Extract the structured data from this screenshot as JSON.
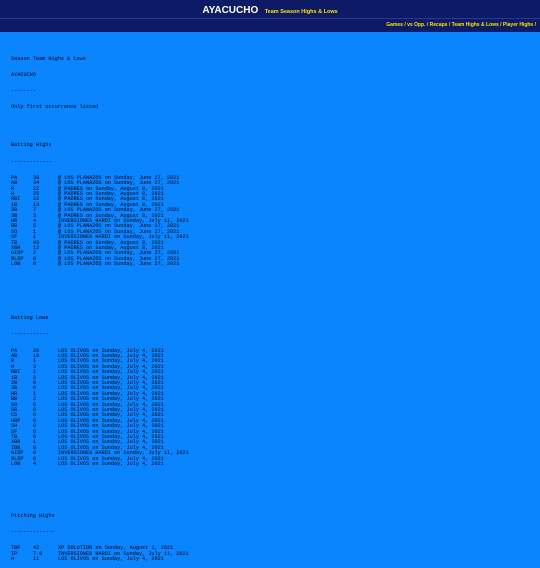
{
  "header": {
    "title": "AYACUCHO",
    "subtitle": "Team Season Highs & Lows"
  },
  "nav": [
    "Games",
    "vs Opp.",
    "Recaps",
    "Team Highs & Lows",
    "Player Highs"
  ],
  "intro": [
    "Season Team Highs & Lows",
    "AYACUCHO",
    "--------",
    "Only first occurrence listed"
  ],
  "batting_highs": {
    "title": "Batting Highs",
    "underline": "-------------",
    "rows": [
      [
        "PA",
        "39",
        "@ LOS PLANAZOS on Sunday, June 27, 2021"
      ],
      [
        "AB",
        "34",
        "@ LOS PLANAZOS on Sunday, June 27, 2021"
      ],
      [
        "R",
        "22",
        "@ PADRES on Sunday, August 8, 2021"
      ],
      [
        "H",
        "25",
        "@ PADRES on Sunday, August 8, 2021"
      ],
      [
        "RBI",
        "22",
        "@ PADRES on Sunday, August 8, 2021"
      ],
      [
        "1B",
        "13",
        "@ PADRES on Sunday, August 8, 2021"
      ],
      [
        "2B",
        "7",
        "@ LOS PLANAZOS on Sunday, June 27, 2021"
      ],
      [
        "3B",
        "3",
        "@ PADRES on Sunday, August 8, 2021"
      ],
      [
        "HR",
        "4",
        "INVERSIONES HARDI on Sunday, July 11, 2021"
      ],
      [
        "BB",
        "5",
        "@ LOS PLANAZOS on Sunday, June 27, 2021"
      ],
      [
        "SO",
        "1",
        "@ LOS PLANAZOS on Sunday, June 27, 2021"
      ],
      [
        "SF",
        "1",
        "INVERSIONES HARDI on Sunday, July 11, 2021"
      ],
      [
        "TB",
        "43",
        "@ PADRES on Sunday, August 8, 2021"
      ],
      [
        "XBH",
        "12",
        "@ PADRES on Sunday, August 8, 2021"
      ],
      [
        "GIDP",
        "2",
        "@ LOS PLANAZOS on Sunday, June 27, 2021"
      ],
      [
        "RLSP",
        "8",
        "@ LOS PLANAZOS on Sunday, June 27, 2021"
      ],
      [
        "LOB",
        "9",
        "@ LOS PLANAZOS on Sunday, June 27, 2021"
      ]
    ]
  },
  "batting_lows": {
    "title": "Batting Lows",
    "underline": "------------",
    "rows": [
      [
        "PA",
        "20",
        "LOS OLIVOS on Sunday, July 4, 2021"
      ],
      [
        "AB",
        "18",
        "LOS OLIVOS on Sunday, July 4, 2021"
      ],
      [
        "R",
        "1",
        "LOS OLIVOS on Sunday, July 4, 2021"
      ],
      [
        "H",
        "3",
        "LOS OLIVOS on Sunday, July 4, 2021"
      ],
      [
        "RBI",
        "1",
        "LOS OLIVOS on Sunday, July 4, 2021"
      ],
      [
        "1B",
        "2",
        "LOS OLIVOS on Sunday, July 4, 2021"
      ],
      [
        "2B",
        "0",
        "LOS OLIVOS on Sunday, July 4, 2021"
      ],
      [
        "3B",
        "0",
        "LOS OLIVOS on Sunday, July 4, 2021"
      ],
      [
        "HR",
        "1",
        "LOS OLIVOS on Sunday, July 4, 2021"
      ],
      [
        "BB",
        "2",
        "LOS OLIVOS on Sunday, July 4, 2021"
      ],
      [
        "SO",
        "6",
        "LOS OLIVOS on Sunday, July 4, 2021"
      ],
      [
        "SB",
        "0",
        "LOS OLIVOS on Sunday, July 4, 2021"
      ],
      [
        "CS",
        "0",
        "LOS OLIVOS on Sunday, July 4, 2021"
      ],
      [
        "HBP",
        "0",
        "LOS OLIVOS on Sunday, July 4, 2021"
      ],
      [
        "SH",
        "0",
        "LOS OLIVOS on Sunday, July 4, 2021"
      ],
      [
        "SF",
        "0",
        "LOS OLIVOS on Sunday, July 4, 2021"
      ],
      [
        "TB",
        "6",
        "LOS OLIVOS on Sunday, July 4, 2021"
      ],
      [
        "XBH",
        "1",
        "LOS OLIVOS on Sunday, July 4, 2021"
      ],
      [
        "IBB",
        "0",
        "LOS OLIVOS on Sunday, July 4, 2021"
      ],
      [
        "GIDP",
        "0",
        "INVERSIONES HARDI on Sunday, July 11, 2021"
      ],
      [
        "RLSP",
        "0",
        "LOS OLIVOS on Sunday, July 4, 2021"
      ],
      [
        "LOB",
        "4",
        "LOS OLIVOS on Sunday, July 4, 2021"
      ]
    ]
  },
  "pitching_highs": {
    "title": "Pitching Highs",
    "underline": "--------------",
    "rows": [
      [
        "TBF",
        "42",
        "XP SOLUTION on Sunday, August 1, 2021"
      ],
      [
        "IP",
        "7.0",
        "INVERSIONES HARDI on Sunday, July 11, 2021"
      ],
      [
        "H",
        "11",
        "LOS OLIVOS on Sunday, July 4, 2021"
      ]
    ]
  }
}
